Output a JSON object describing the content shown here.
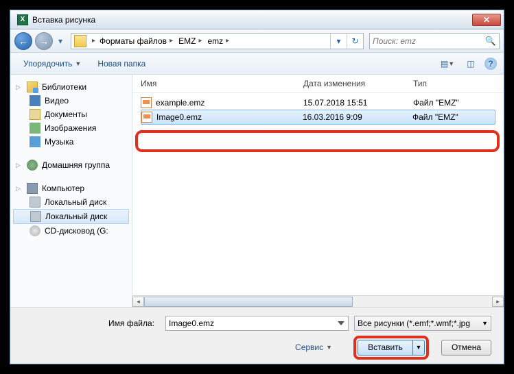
{
  "title": "Вставка рисунка",
  "breadcrumb": [
    "Форматы файлов",
    "EMZ",
    "emz"
  ],
  "search_placeholder": "Поиск: emz",
  "toolbar": {
    "organize": "Упорядочить",
    "newfolder": "Новая папка"
  },
  "sidebar": {
    "libraries": "Библиотеки",
    "video": "Видео",
    "documents": "Документы",
    "images": "Изображения",
    "music": "Музыка",
    "homegroup": "Домашняя группа",
    "computer": "Компьютер",
    "localdisk1": "Локальный диск",
    "localdisk2": "Локальный диск",
    "cddrive": "CD-дисковод (G:"
  },
  "columns": {
    "name": "Имя",
    "date": "Дата изменения",
    "type": "Тип"
  },
  "files": [
    {
      "name": "example.emz",
      "date": "15.07.2018 15:51",
      "type": "Файл \"EMZ\""
    },
    {
      "name": "Image0.emz",
      "date": "16.03.2016 9:09",
      "type": "Файл \"EMZ\""
    }
  ],
  "footer": {
    "filename_label": "Имя файла:",
    "filename_value": "Image0.emz",
    "filter": "Все рисунки (*.emf;*.wmf;*.jpg",
    "service": "Сервис",
    "insert": "Вставить",
    "cancel": "Отмена"
  }
}
